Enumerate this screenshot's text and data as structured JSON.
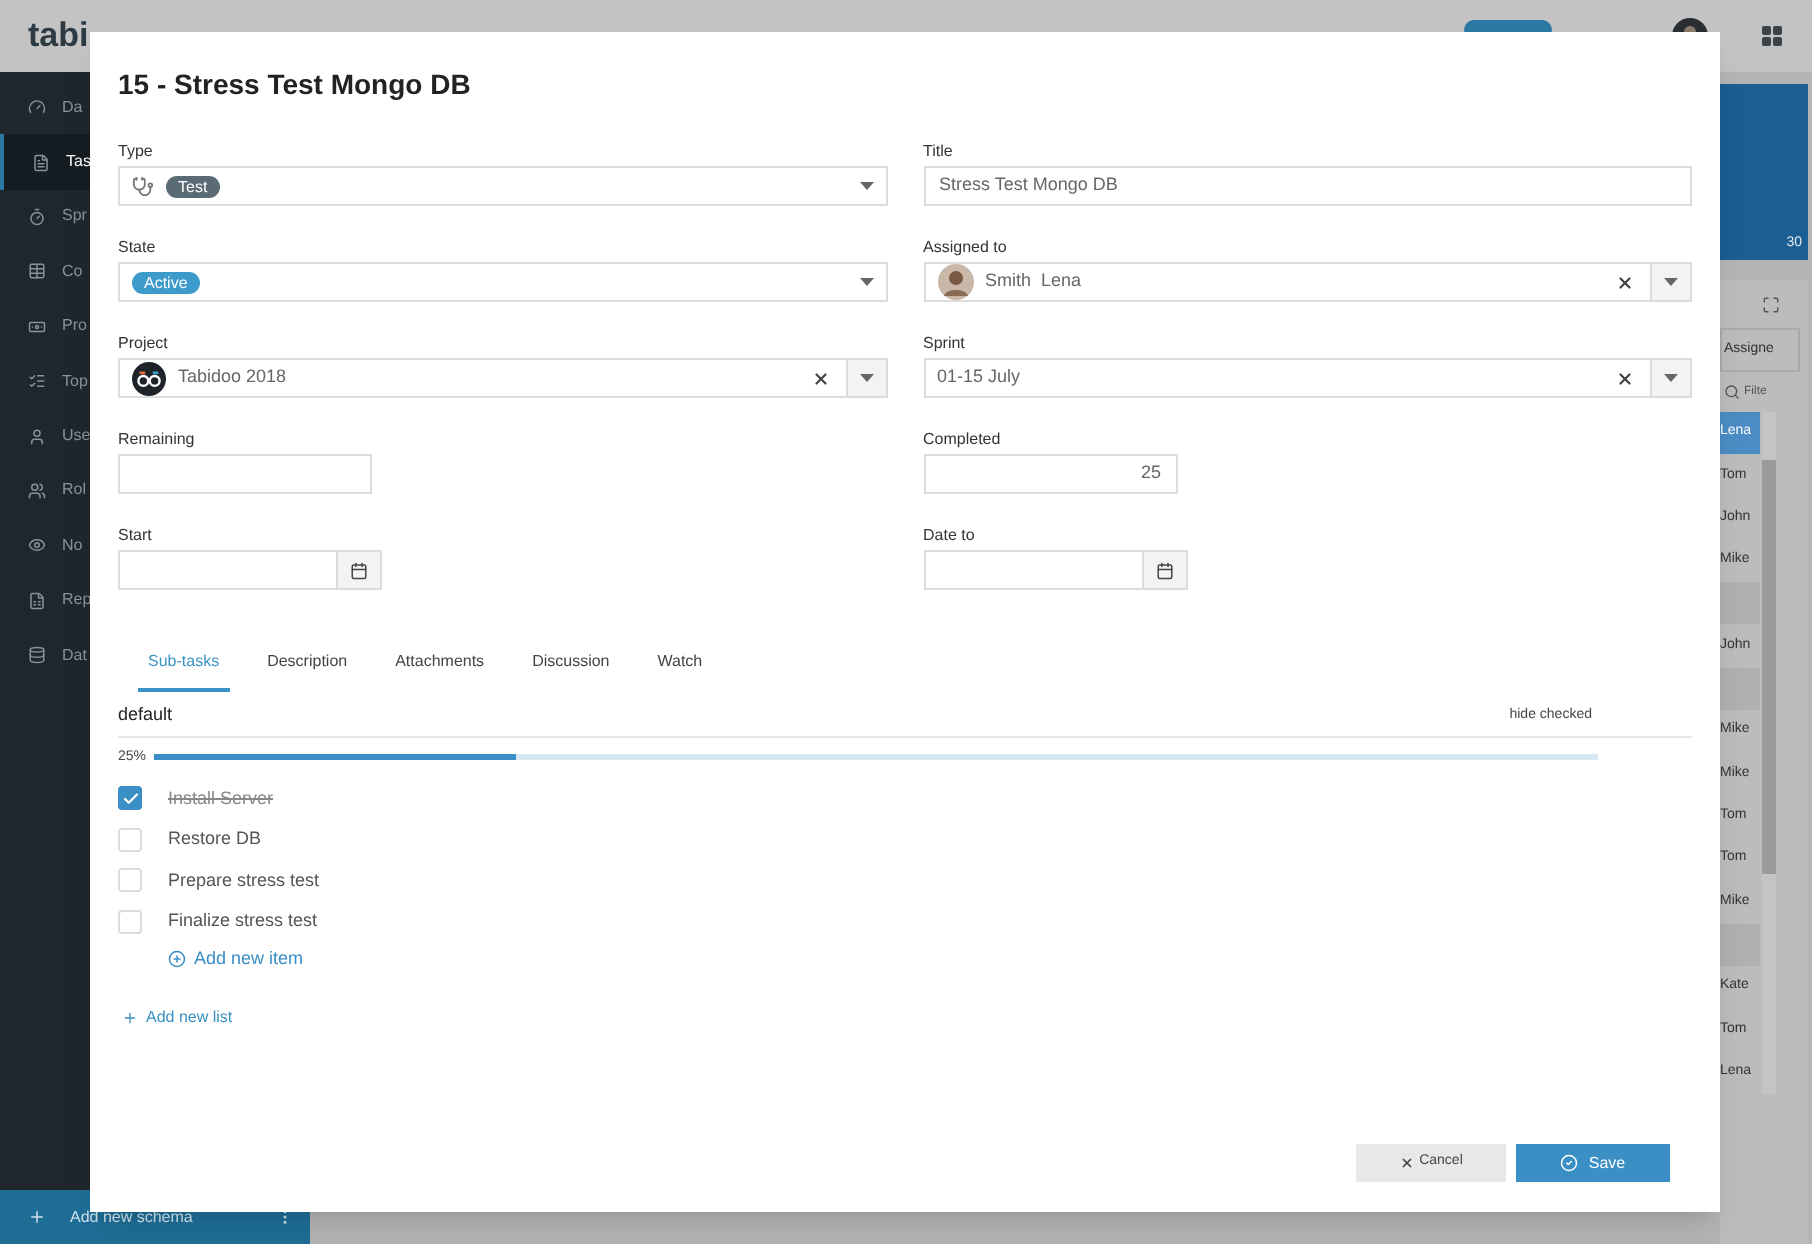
{
  "background": {
    "logo": "tabi",
    "nav": [
      {
        "label": "Da",
        "selected": false
      },
      {
        "label": "Tas",
        "selected": true
      },
      {
        "label": "Spr",
        "selected": false
      },
      {
        "label": "Co",
        "selected": false
      },
      {
        "label": "Pro",
        "selected": false
      },
      {
        "label": "Top",
        "selected": false
      },
      {
        "label": "Use",
        "selected": false
      },
      {
        "label": "Rol",
        "selected": false
      },
      {
        "label": "No",
        "selected": false
      },
      {
        "label": "Rep",
        "selected": false
      },
      {
        "label": "Dat",
        "selected": false
      }
    ],
    "add_schema": "Add new schema",
    "chart_reading": "30",
    "column_header": "Assigne",
    "filter_placeholder": "Filte",
    "rows": [
      {
        "kind": "name",
        "name": "Lena",
        "selected": true
      },
      {
        "kind": "name",
        "name": "Tom",
        "selected": false
      },
      {
        "kind": "name",
        "name": "John",
        "selected": false
      },
      {
        "kind": "name",
        "name": "Mike",
        "selected": false
      },
      {
        "kind": "empty",
        "selected": false
      },
      {
        "kind": "name",
        "name": "John",
        "selected": false
      },
      {
        "kind": "empty",
        "selected": false
      },
      {
        "kind": "name",
        "name": "Mike",
        "selected": false
      },
      {
        "kind": "name",
        "name": "Mike",
        "selected": false
      },
      {
        "kind": "name",
        "name": "Tom",
        "selected": false
      },
      {
        "kind": "name",
        "name": "Tom",
        "selected": false
      },
      {
        "kind": "name",
        "name": "Mike",
        "selected": false
      },
      {
        "kind": "empty",
        "selected": false
      },
      {
        "kind": "name",
        "name": "Kate",
        "selected": false
      },
      {
        "kind": "name",
        "name": "Tom",
        "selected": false
      },
      {
        "kind": "name",
        "name": "Lena",
        "selected": false
      }
    ]
  },
  "dialog": {
    "title": "15 - Stress Test Mongo DB",
    "fields": [
      {
        "label": "Type",
        "kind": "tag-select",
        "tag": "Test",
        "color": "#5b6b76"
      },
      {
        "label": "Title",
        "kind": "text",
        "value": "Stress Test Mongo DB"
      },
      {
        "label": "State",
        "kind": "tag-select",
        "tag": "Active",
        "color": "#3d9bcc"
      },
      {
        "label": "Assigned to",
        "kind": "lookup",
        "value": "Smith  Lena"
      },
      {
        "label": "Project",
        "kind": "lookup",
        "value": "Tabidoo 2018"
      },
      {
        "label": "Sprint",
        "kind": "lookup",
        "value": "01-15 July"
      },
      {
        "label": "Remaining",
        "kind": "short"
      },
      {
        "label": "Completed",
        "kind": "short",
        "value": "25"
      },
      {
        "label": "Start",
        "kind": "date"
      },
      {
        "label": "Date to",
        "kind": "date"
      }
    ],
    "tabs": [
      {
        "label": "Sub-tasks",
        "selected": true
      },
      {
        "label": "Description",
        "selected": false
      },
      {
        "label": "Attachments",
        "selected": false
      },
      {
        "label": "Discussion",
        "selected": false
      },
      {
        "label": "Watch",
        "selected": false
      }
    ],
    "checklist": {
      "name": "default",
      "hide_button": "hide checked",
      "percent": "25%",
      "level": 0.25,
      "items": [
        {
          "text": "Install Server",
          "checked": true
        },
        {
          "text": "Restore DB",
          "checked": false
        },
        {
          "text": "Prepare stress test",
          "checked": false
        },
        {
          "text": "Finalize stress test",
          "checked": false
        }
      ],
      "add_item": "Add new item"
    },
    "add_list": "Add new list",
    "buttons": [
      {
        "kind": "cancel",
        "label": "Cancel"
      },
      {
        "kind": "save",
        "label": "Save"
      }
    ]
  }
}
